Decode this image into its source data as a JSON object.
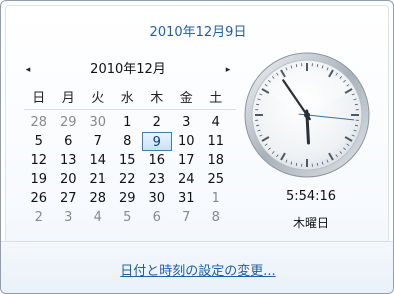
{
  "header": {
    "date": "2010年12月9日"
  },
  "calendar": {
    "month_label": "2010年12月",
    "prev_glyph": "◂",
    "next_glyph": "▸",
    "weekdays": [
      "日",
      "月",
      "火",
      "水",
      "木",
      "金",
      "土"
    ],
    "weeks": [
      [
        "28",
        "29",
        "30",
        "1",
        "2",
        "3",
        "4"
      ],
      [
        "5",
        "6",
        "7",
        "8",
        "9",
        "10",
        "11"
      ],
      [
        "12",
        "13",
        "14",
        "15",
        "16",
        "17",
        "18"
      ],
      [
        "19",
        "20",
        "21",
        "22",
        "23",
        "24",
        "25"
      ],
      [
        "26",
        "27",
        "28",
        "29",
        "30",
        "31",
        "1"
      ],
      [
        "2",
        "3",
        "4",
        "5",
        "6",
        "7",
        "8"
      ]
    ],
    "selected_day": "9"
  },
  "clock": {
    "time": "5:54:16",
    "weekday": "木曜日",
    "hours": 5,
    "minutes": 54,
    "seconds": 16
  },
  "footer": {
    "link": "日付と時刻の設定の変更..."
  }
}
